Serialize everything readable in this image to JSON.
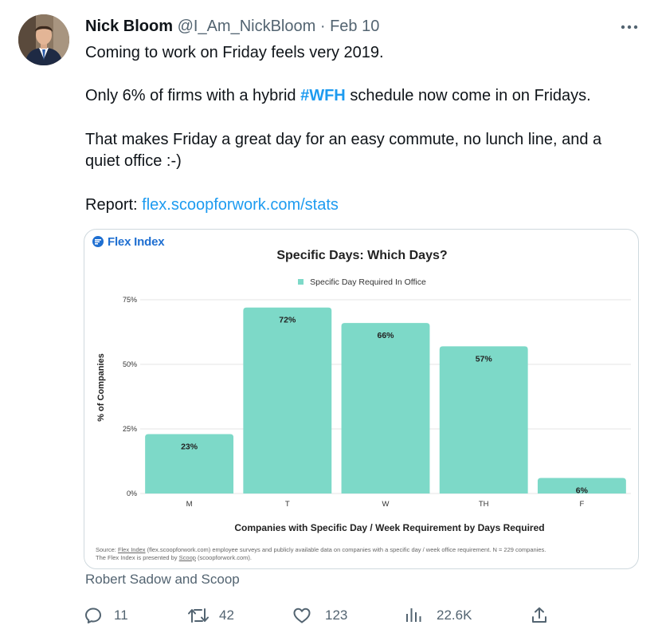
{
  "tweet": {
    "author_name": "Nick Bloom",
    "author_handle": "@I_Am_NickBloom",
    "separator": "·",
    "date": "Feb 10",
    "line1": "Coming to work on Friday feels very 2019.",
    "line2_before": "Only 6% of firms with a hybrid ",
    "line2_hashtag": "#WFH",
    "line2_after": " schedule now come in on Fridays.",
    "line3a": "That makes Friday a great day for an easy commute, no lunch line, and a",
    "line3b": "quiet office :-)",
    "report_label": "Report: ",
    "report_link": "flex.scoopforwork.com/stats",
    "attribution": "Robert Sadow and Scoop"
  },
  "card": {
    "logo_text": "Flex Index",
    "source_line1_pre": "Source: ",
    "source_line1_link": "Flex Index",
    "source_line1_post": " (flex.scoopforwork.com) employee surveys and publicly available data on companies with a specific day / week office requirement. N = 229 companies.",
    "source_line2_pre": "The Flex Index is presented by ",
    "source_line2_link": "Scoop",
    "source_line2_post": " (scoopforwork.com)."
  },
  "chart_data": {
    "type": "bar",
    "title": "Specific Days: Which Days?",
    "xlabel": "Companies with Specific Day / Week Requirement by Days Required",
    "ylabel": "% of Companies",
    "categories": [
      "M",
      "T",
      "W",
      "TH",
      "F"
    ],
    "series": [
      {
        "name": "Specific Day Required In Office",
        "values": [
          23,
          72,
          66,
          57,
          6
        ],
        "color": "#7dd9c8"
      }
    ],
    "data_labels": [
      "23%",
      "72%",
      "66%",
      "57%",
      "6%"
    ],
    "yticks": [
      0,
      25,
      50,
      75
    ],
    "ytick_labels": [
      "0%",
      "25%",
      "50%",
      "75%"
    ],
    "ylim": [
      0,
      75
    ],
    "grid": true,
    "legend_position": "top-center"
  },
  "actions": {
    "reply_count": "11",
    "retweet_count": "42",
    "like_count": "123",
    "views_count": "22.6K"
  },
  "colors": {
    "accent": "#1d9bf0",
    "text_secondary": "#536471",
    "bar": "#7dd9c8"
  }
}
